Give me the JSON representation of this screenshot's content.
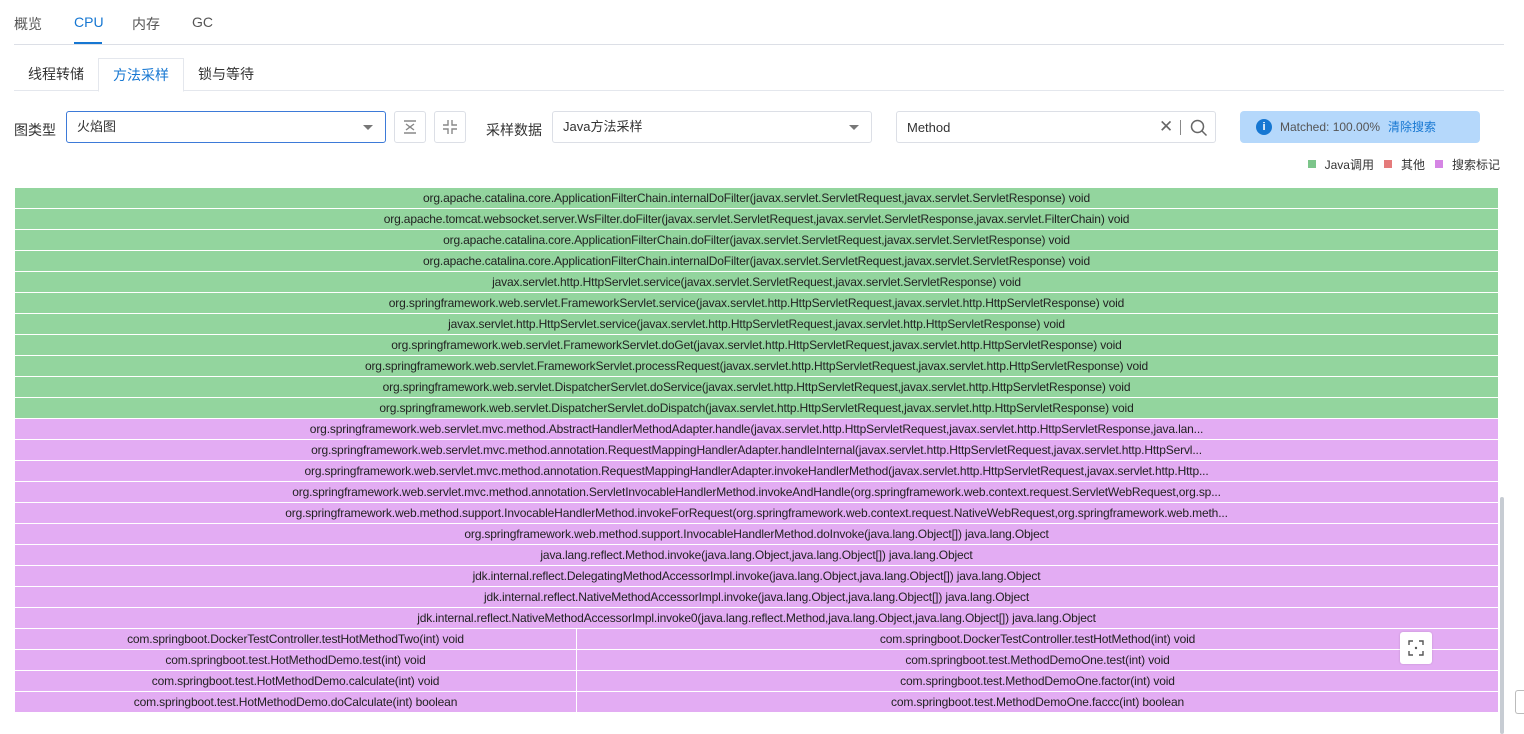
{
  "top_tabs": [
    {
      "label": "概览",
      "active": false
    },
    {
      "label": "CPU",
      "active": true
    },
    {
      "label": "内存",
      "active": false
    },
    {
      "label": "GC",
      "active": false
    }
  ],
  "sub_tabs": [
    {
      "label": "线程转储",
      "active": false
    },
    {
      "label": "方法采样",
      "active": true
    },
    {
      "label": "锁与等待",
      "active": false
    }
  ],
  "filters": {
    "chart_type_label": "图类型",
    "chart_type_value": "火焰图",
    "sample_label": "采样数据",
    "sample_value": "Java方法采样",
    "search_value": "Method",
    "matched_text": "Matched:  100.00%",
    "clear_search": "清除搜索"
  },
  "legend": [
    {
      "label": "Java调用",
      "color": "#7cc58a"
    },
    {
      "label": "其他",
      "color": "#e57b7b"
    },
    {
      "label": "搜索标记",
      "color": "#d585e4"
    }
  ],
  "colors": {
    "accent": "#1677d2",
    "java_frame": "#93d59e",
    "search_frame": "#e3acf3"
  },
  "flame_graph": {
    "frames": [
      {
        "label": "org.apache.catalina.core.ApplicationFilterChain.internalDoFilter(javax.servlet.ServletRequest,javax.servlet.ServletResponse) void",
        "kind": "java",
        "level": 0
      },
      {
        "label": "org.apache.tomcat.websocket.server.WsFilter.doFilter(javax.servlet.ServletRequest,javax.servlet.ServletResponse,javax.servlet.FilterChain) void",
        "kind": "java",
        "level": 1
      },
      {
        "label": "org.apache.catalina.core.ApplicationFilterChain.doFilter(javax.servlet.ServletRequest,javax.servlet.ServletResponse) void",
        "kind": "java",
        "level": 2
      },
      {
        "label": "org.apache.catalina.core.ApplicationFilterChain.internalDoFilter(javax.servlet.ServletRequest,javax.servlet.ServletResponse) void",
        "kind": "java",
        "level": 3
      },
      {
        "label": "javax.servlet.http.HttpServlet.service(javax.servlet.ServletRequest,javax.servlet.ServletResponse) void",
        "kind": "java",
        "level": 4
      },
      {
        "label": "org.springframework.web.servlet.FrameworkServlet.service(javax.servlet.http.HttpServletRequest,javax.servlet.http.HttpServletResponse) void",
        "kind": "java",
        "level": 5
      },
      {
        "label": "javax.servlet.http.HttpServlet.service(javax.servlet.http.HttpServletRequest,javax.servlet.http.HttpServletResponse) void",
        "kind": "java",
        "level": 6
      },
      {
        "label": "org.springframework.web.servlet.FrameworkServlet.doGet(javax.servlet.http.HttpServletRequest,javax.servlet.http.HttpServletResponse) void",
        "kind": "java",
        "level": 7
      },
      {
        "label": "org.springframework.web.servlet.FrameworkServlet.processRequest(javax.servlet.http.HttpServletRequest,javax.servlet.http.HttpServletResponse) void",
        "kind": "java",
        "level": 8
      },
      {
        "label": "org.springframework.web.servlet.DispatcherServlet.doService(javax.servlet.http.HttpServletRequest,javax.servlet.http.HttpServletResponse) void",
        "kind": "java",
        "level": 9
      },
      {
        "label": "org.springframework.web.servlet.DispatcherServlet.doDispatch(javax.servlet.http.HttpServletRequest,javax.servlet.http.HttpServletResponse) void",
        "kind": "java",
        "level": 10
      },
      {
        "label": "org.springframework.web.servlet.mvc.method.AbstractHandlerMethodAdapter.handle(javax.servlet.http.HttpServletRequest,javax.servlet.http.HttpServletResponse,java.lan...",
        "kind": "search",
        "level": 11
      },
      {
        "label": "org.springframework.web.servlet.mvc.method.annotation.RequestMappingHandlerAdapter.handleInternal(javax.servlet.http.HttpServletRequest,javax.servlet.http.HttpServl...",
        "kind": "search",
        "level": 12
      },
      {
        "label": "org.springframework.web.servlet.mvc.method.annotation.RequestMappingHandlerAdapter.invokeHandlerMethod(javax.servlet.http.HttpServletRequest,javax.servlet.http.Http...",
        "kind": "search",
        "level": 13
      },
      {
        "label": "org.springframework.web.servlet.mvc.method.annotation.ServletInvocableHandlerMethod.invokeAndHandle(org.springframework.web.context.request.ServletWebRequest,org.sp...",
        "kind": "search",
        "level": 14
      },
      {
        "label": "org.springframework.web.method.support.InvocableHandlerMethod.invokeForRequest(org.springframework.web.context.request.NativeWebRequest,org.springframework.web.meth...",
        "kind": "search",
        "level": 15
      },
      {
        "label": "org.springframework.web.method.support.InvocableHandlerMethod.doInvoke(java.lang.Object[]) java.lang.Object",
        "kind": "search",
        "level": 16
      },
      {
        "label": "java.lang.reflect.Method.invoke(java.lang.Object,java.lang.Object[]) java.lang.Object",
        "kind": "search",
        "level": 17
      },
      {
        "label": "jdk.internal.reflect.DelegatingMethodAccessorImpl.invoke(java.lang.Object,java.lang.Object[]) java.lang.Object",
        "kind": "search",
        "level": 18
      },
      {
        "label": "jdk.internal.reflect.NativeMethodAccessorImpl.invoke(java.lang.Object,java.lang.Object[]) java.lang.Object",
        "kind": "search",
        "level": 19
      },
      {
        "label": "jdk.internal.reflect.NativeMethodAccessorImpl.invoke0(java.lang.reflect.Method,java.lang.Object,java.lang.Object[]) java.lang.Object",
        "kind": "search",
        "level": 20
      },
      {
        "label": "com.springboot.DockerTestController.testHotMethodTwo(int) void",
        "kind": "search",
        "level": 21,
        "column": "left"
      },
      {
        "label": "com.springboot.DockerTestController.testHotMethod(int) void",
        "kind": "search",
        "level": 21,
        "column": "right"
      },
      {
        "label": "com.springboot.test.HotMethodDemo.test(int) void",
        "kind": "search",
        "level": 22,
        "column": "left"
      },
      {
        "label": "com.springboot.test.MethodDemoOne.test(int) void",
        "kind": "search",
        "level": 22,
        "column": "right"
      },
      {
        "label": "com.springboot.test.HotMethodDemo.calculate(int) void",
        "kind": "search",
        "level": 23,
        "column": "left"
      },
      {
        "label": "com.springboot.test.MethodDemoOne.factor(int) void",
        "kind": "search",
        "level": 23,
        "column": "right"
      },
      {
        "label": "com.springboot.test.HotMethodDemo.doCalculate(int) boolean",
        "kind": "search",
        "level": 24,
        "column": "left"
      },
      {
        "label": "com.springboot.test.MethodDemoOne.faccc(int) boolean",
        "kind": "search",
        "level": 24,
        "column": "right"
      }
    ]
  }
}
